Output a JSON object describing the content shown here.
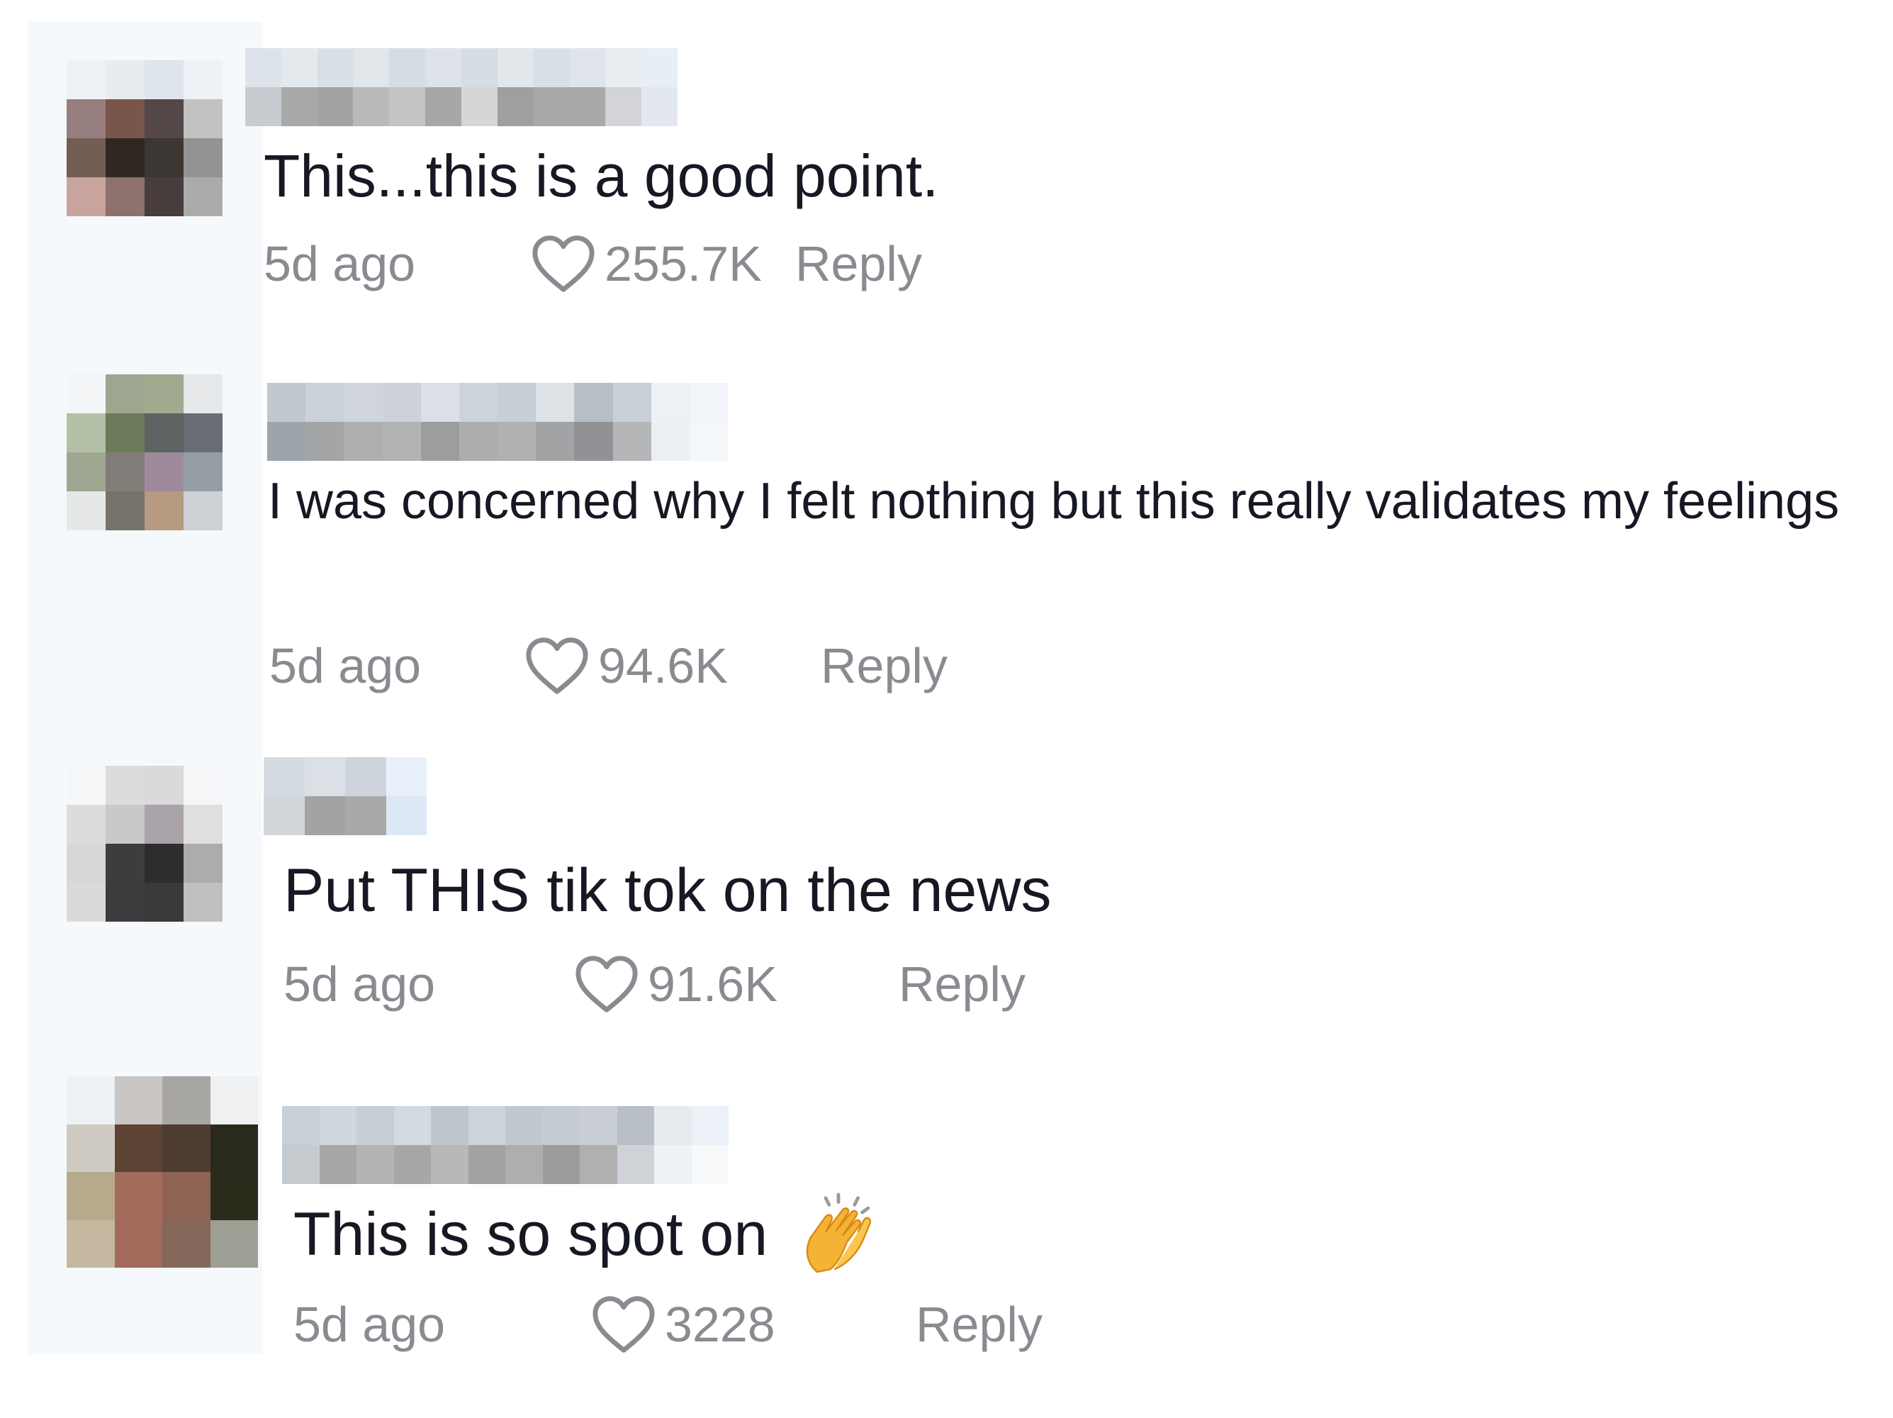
{
  "comments": [
    {
      "text": "This...this is a good point.",
      "time": "5d ago",
      "likes": "255.7K",
      "reply": "Reply",
      "avatar_colors": [
        "#eef2f6",
        "#e7ecf1",
        "#dfe5ec",
        "#eef2f6",
        "#977f80",
        "#7a5549",
        "#544747",
        "#c2c2c2",
        "#725e54",
        "#2f2722",
        "#3d3734",
        "#939393",
        "#c9a49d",
        "#8c716f",
        "#463d3c",
        "#ababab"
      ],
      "username_colors": [
        "#dde3ea",
        "#e4e9ee",
        "#d9dfe6",
        "#e1e6eb",
        "#d5dce3",
        "#dee3e9",
        "#d7dde4",
        "#e2e7ec",
        "#d9dfe6",
        "#dfe4ea",
        "#e8edf2",
        "#e8eef5",
        "#c8ccd1",
        "#a9a9a9",
        "#a3a3a3",
        "#b9b9b9",
        "#c4c4c4",
        "#a7a7a7",
        "#d6d6d6",
        "#9f9f9f",
        "#a8a8a8",
        "#a9a9a9",
        "#d2d4d8",
        "#e3e8ee"
      ]
    },
    {
      "text": "I was concerned why I felt nothing but this really validates my feelings",
      "time": "5d ago",
      "likes": "94.6K",
      "reply": "Reply",
      "avatar_colors": [
        "#f3f5f7",
        "#9ea68f",
        "#a1a98e",
        "#e6e8ea",
        "#b3c0a5",
        "#6c7b5a",
        "#5d6462",
        "#686e73",
        "#a0a791",
        "#827d78",
        "#9f8a9c",
        "#959ea3",
        "#e6e8e8",
        "#77726a",
        "#b69a82",
        "#cfd2d4"
      ],
      "username_colors": [
        "#c1c7cf",
        "#cbd1d8",
        "#d0d5dc",
        "#cdd2d8",
        "#dbe0e6",
        "#cdd3da",
        "#c8ced6",
        "#dde2e7",
        "#b8bec6",
        "#c9cfd6",
        "#ecf1f6",
        "#f1f5f9",
        "#9ea4ab",
        "#a4a5a7",
        "#afafaf",
        "#b2b3b5",
        "#9c9d9f",
        "#acadaf",
        "#b1b1b1",
        "#a2a3a5",
        "#909295",
        "#b5b6b7",
        "#ebeef2",
        "#f4f7fa"
      ]
    },
    {
      "text": "Put THIS tik tok on the news",
      "time": "5d ago",
      "likes": "91.6K",
      "reply": "Reply",
      "avatar_colors": [
        "#f4f6f8",
        "#dcdcdc",
        "#dadada",
        "#f4f6f8",
        "#dcdcdc",
        "#cac9c8",
        "#aba3aa",
        "#e0dfe0",
        "#d7d7d7",
        "#3f3c3f",
        "#2e2c2e",
        "#adabad",
        "#dadada",
        "#3e3c3e",
        "#3a383a",
        "#c0bfc0"
      ],
      "username_colors": [
        "#d5dbe2",
        "#dae0e6",
        "#ced4db",
        "#e8f1fb",
        "#ffffff",
        "#ffffff",
        "#ffffff",
        "#ffffff",
        "#ffffff",
        "#ffffff",
        "#ffffff",
        "#ffffff",
        "#d2d6db",
        "#a3a3a3",
        "#a9a9a9",
        "#dce8f6",
        "#ffffff",
        "#ffffff",
        "#ffffff",
        "#ffffff",
        "#ffffff",
        "#ffffff",
        "#ffffff",
        "#ffffff"
      ]
    },
    {
      "text": "This is so spot on",
      "emoji": "clapping-hands",
      "time": "5d ago",
      "likes": "3228",
      "reply": "Reply",
      "avatar_colors": [
        "#eef2f6",
        "#c9c6c3",
        "#a8a6a3",
        "#eef0f2",
        "#cfcac2",
        "#5c4333",
        "#4e3d30",
        "#2a2a1c",
        "#b7a98b",
        "#a26b5c",
        "#8e6353",
        "#2b2b1c",
        "#c4b8a1",
        "#a36a5b",
        "#86685a",
        "#9ea095"
      ],
      "username_colors": [
        "#c9cfd6",
        "#d1d7de",
        "#c8ced5",
        "#d4dae1",
        "#bfc6ce",
        "#cdd3da",
        "#c1c8cf",
        "#c6ccd3",
        "#c9ced5",
        "#b9bfc6",
        "#e6ebf0",
        "#ecf1f7",
        "#c6cbd0",
        "#a6a6a6",
        "#b3b3b3",
        "#a7a7a7",
        "#b8b8b8",
        "#a2a2a2",
        "#aeaeae",
        "#9c9c9c",
        "#b0b0b0",
        "#cfd2d6",
        "#eef2f6",
        "#f7f9fb"
      ]
    }
  ]
}
